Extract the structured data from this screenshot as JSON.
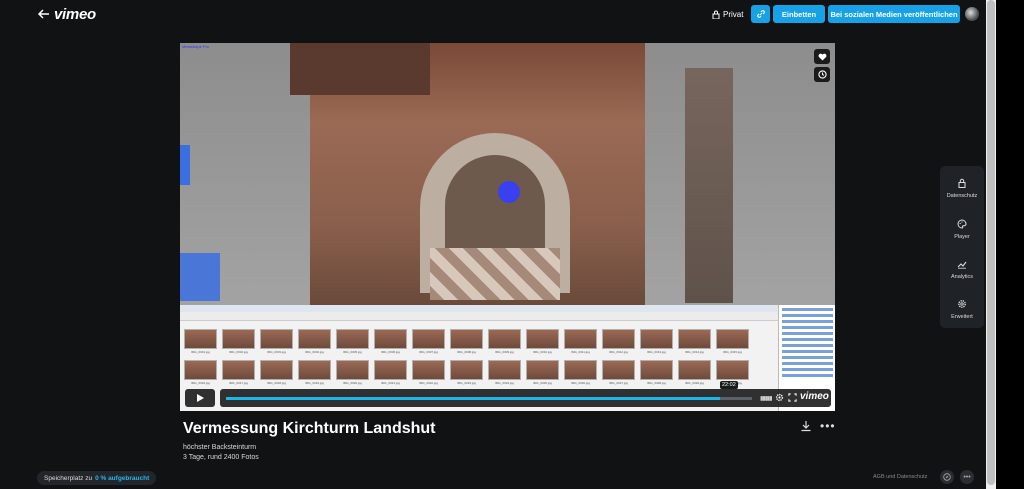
{
  "header": {
    "logo": "vimeo",
    "privacy_label": "Privat",
    "embed_label": "Einbetten",
    "share_label": "Bei sozialen Medien veröffentlichen"
  },
  "player": {
    "software_label": "Metashape Pro",
    "progress": 0.94,
    "time": "22:02",
    "brand": "vimeo",
    "thumb_captions": [
      "IMG_0001.jpg",
      "IMG_0002.jpg",
      "IMG_0003.jpg",
      "IMG_0004.jpg",
      "IMG_0005.jpg",
      "IMG_0006.jpg",
      "IMG_0007.jpg",
      "IMG_0008.jpg",
      "IMG_0009.jpg",
      "IMG_0010.jpg",
      "IMG_0011.jpg",
      "IMG_0012.jpg",
      "IMG_0013.jpg",
      "IMG_0014.jpg",
      "IMG_0015.jpg",
      "IMG_0016.jpg",
      "IMG_0017.jpg",
      "IMG_0018.jpg",
      "IMG_0019.jpg",
      "IMG_0020.jpg",
      "IMG_0021.jpg",
      "IMG_0022.jpg",
      "IMG_0023.jpg",
      "IMG_0024.jpg",
      "IMG_0025.jpg",
      "IMG_0026.jpg",
      "IMG_0027.jpg",
      "IMG_0028.jpg",
      "IMG_0029.jpg",
      "IMG_0030.jpg"
    ]
  },
  "side_menu": {
    "items": [
      {
        "label": "Datenschutz",
        "icon": "lock-icon"
      },
      {
        "label": "Player",
        "icon": "palette-icon"
      },
      {
        "label": "Analytics",
        "icon": "chart-icon"
      },
      {
        "label": "Erweitert",
        "icon": "gear-icon"
      }
    ]
  },
  "video": {
    "title": "Vermessung Kirchturm Landshut",
    "description_line1": "höchster Backsteinturm",
    "description_line2": "3 Tage, rund 2400 Fotos"
  },
  "footer": {
    "storage_prefix": "Speicherplatz zu",
    "storage_value": "0 % aufgebraucht",
    "legal_link": "AGB und Datenschutz"
  },
  "colors": {
    "accent": "#17a2e8",
    "background": "#101214"
  }
}
